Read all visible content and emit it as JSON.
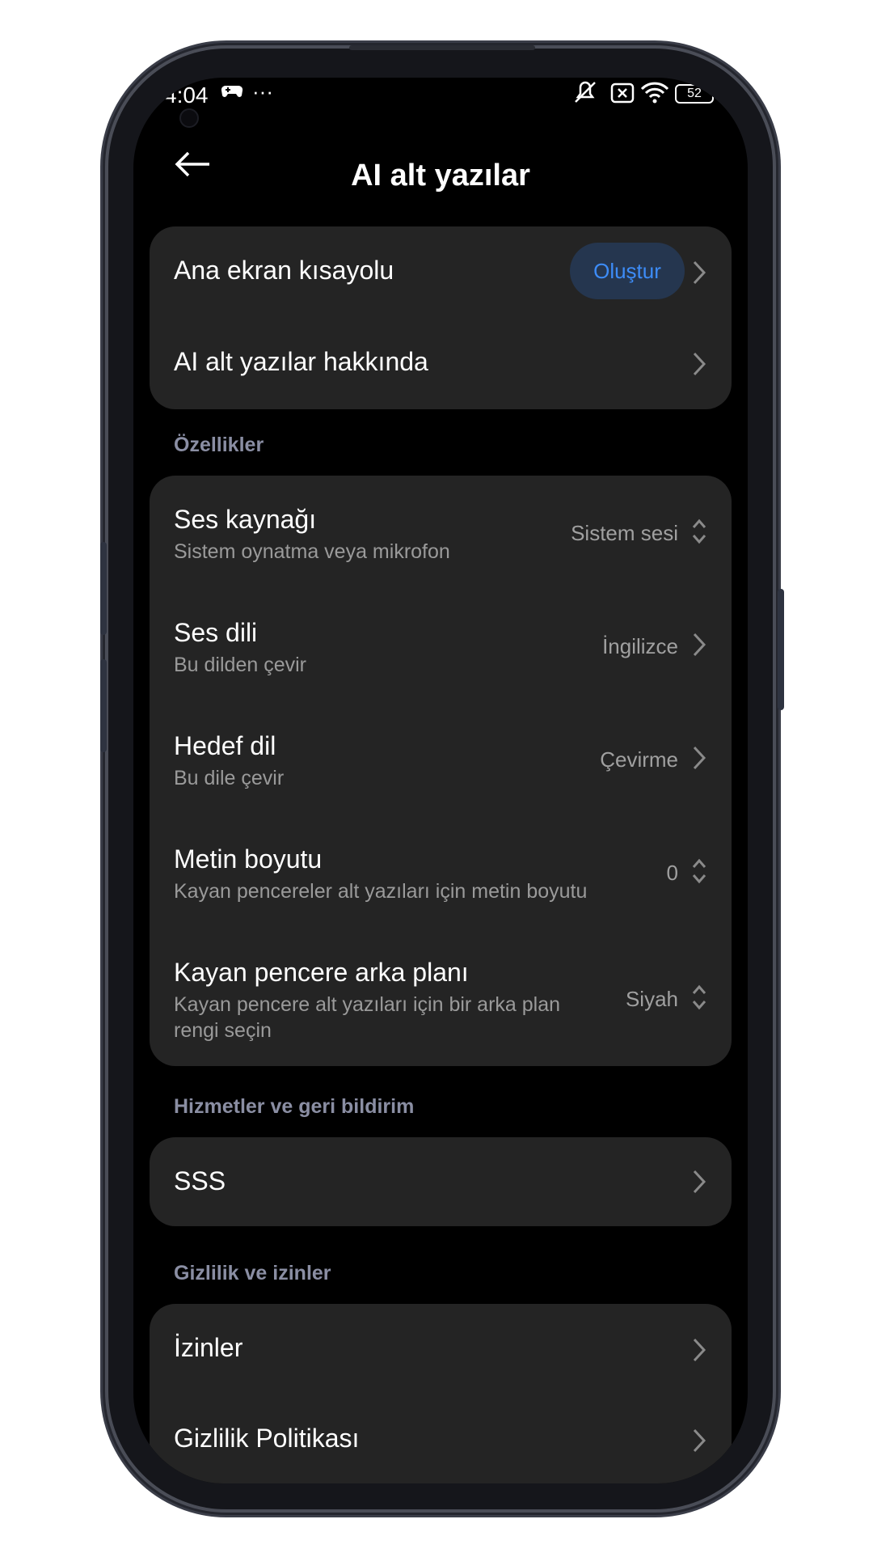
{
  "status_bar": {
    "time": "4:04",
    "icons": [
      "gamepad-icon",
      "more-icon",
      "mute-icon",
      "no-sim-icon",
      "wifi-icon",
      "battery-icon"
    ],
    "more_text": "···",
    "battery": "52"
  },
  "header": {
    "back_icon": "back-arrow-icon",
    "title": "AI alt yazılar"
  },
  "card_top": {
    "rows": [
      {
        "title": "Ana ekran kısayolu",
        "button": "Oluştur"
      },
      {
        "title": "AI alt yazılar hakkında"
      }
    ]
  },
  "features": {
    "label": "Özellikler",
    "rows": [
      {
        "title": "Ses kaynağı",
        "subtitle": "Sistem oynatma veya mikrofon",
        "value": "Sistem sesi",
        "control": "updown"
      },
      {
        "title": "Ses dili",
        "subtitle": "Bu dilden çevir",
        "value": "İngilizce",
        "control": "chevron"
      },
      {
        "title": "Hedef dil",
        "subtitle": "Bu dile çevir",
        "value": "Çevirme",
        "control": "chevron"
      },
      {
        "title": "Metin boyutu",
        "subtitle": "Kayan pencereler alt yazıları için metin boyutu",
        "value": "0",
        "control": "updown"
      },
      {
        "title": "Kayan pencere arka planı",
        "subtitle_line1": "Kayan pencere alt yazıları için bir arka plan",
        "subtitle_line2": "rengi seçin",
        "value": "Siyah",
        "control": "updown"
      }
    ]
  },
  "services": {
    "label": "Hizmetler ve geri bildirim",
    "rows": [
      {
        "title": "SSS"
      }
    ]
  },
  "privacy": {
    "label": "Gizlilik ve izinler",
    "rows": [
      {
        "title": "İzinler"
      },
      {
        "title": "Gizlilik Politikası"
      }
    ]
  },
  "colors": {
    "screen_bg": "#000000",
    "card_bg": "#242424",
    "accent": "#3d8cf7",
    "pill_bg": "#25364f",
    "section_label": "#8a8ea3"
  }
}
